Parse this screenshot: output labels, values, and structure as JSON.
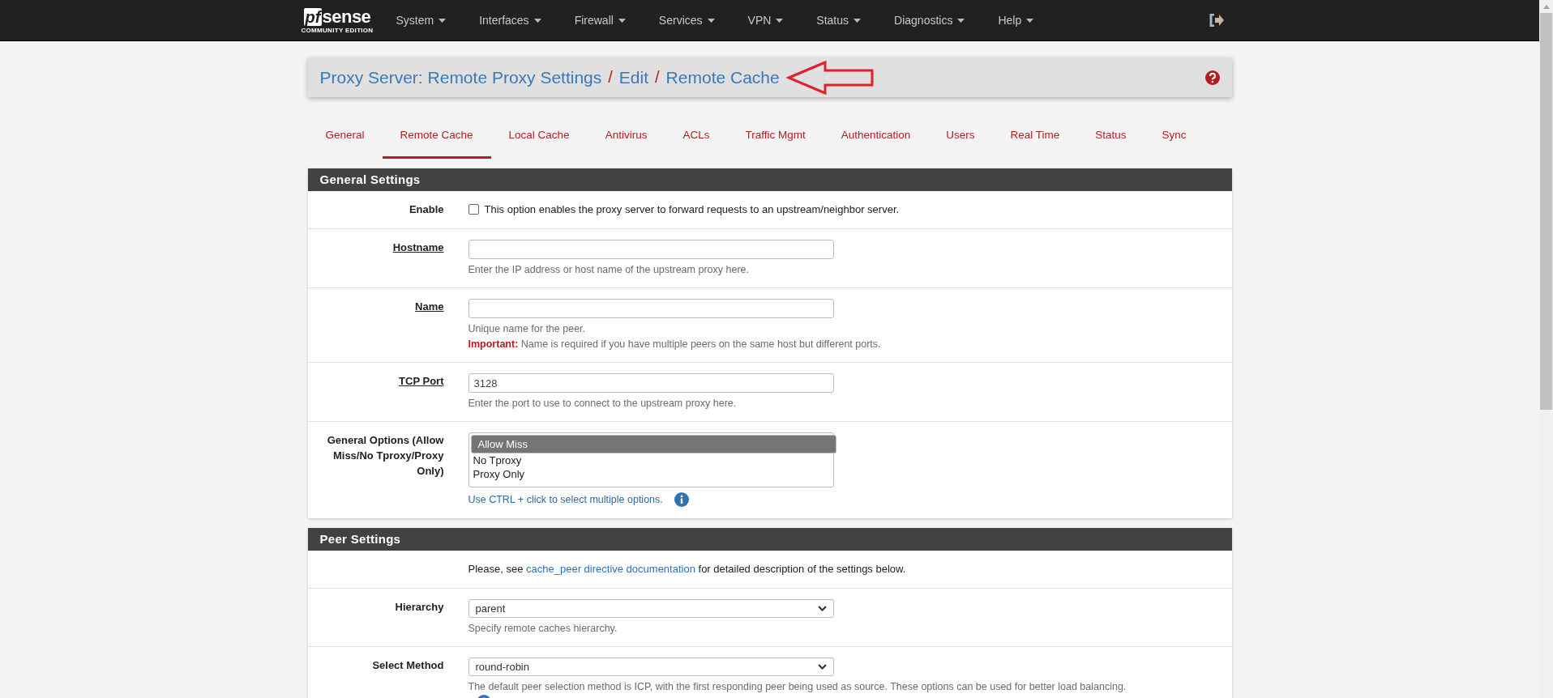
{
  "navbar": {
    "logo": {
      "brand": "sense",
      "mark": "pf",
      "edition": "COMMUNITY EDITION"
    },
    "menus": [
      {
        "label": "System"
      },
      {
        "label": "Interfaces"
      },
      {
        "label": "Firewall"
      },
      {
        "label": "Services"
      },
      {
        "label": "VPN"
      },
      {
        "label": "Status"
      },
      {
        "label": "Diagnostics"
      },
      {
        "label": "Help"
      }
    ]
  },
  "breadcrumb": [
    {
      "label": "Proxy Server: Remote Proxy Settings",
      "separator": "/"
    },
    {
      "label": "Edit",
      "separator": "/"
    },
    {
      "label": "Remote Cache"
    }
  ],
  "tabs": [
    {
      "label": "General",
      "selected": false
    },
    {
      "label": "Remote Cache",
      "selected": true
    },
    {
      "label": "Local Cache",
      "selected": false
    },
    {
      "label": "Antivirus",
      "selected": false
    },
    {
      "label": "ACLs",
      "selected": false
    },
    {
      "label": "Traffic Mgmt",
      "selected": false
    },
    {
      "label": "Authentication",
      "selected": false
    },
    {
      "label": "Users",
      "selected": false
    },
    {
      "label": "Real Time",
      "selected": false
    },
    {
      "label": "Status",
      "selected": false
    },
    {
      "label": "Sync",
      "selected": false
    }
  ],
  "sections": [
    {
      "title": "General Settings",
      "rows": [
        {
          "kind": "checkbox",
          "label": "Enable",
          "underlined": false,
          "checked": false,
          "text": "This option enables the proxy server to forward requests to an upstream/neighbor server."
        },
        {
          "kind": "text",
          "label": "Hostname",
          "underlined": true,
          "value": "",
          "help": [
            "Enter the IP address or host name of the upstream proxy here."
          ]
        },
        {
          "kind": "text",
          "label": "Name",
          "underlined": true,
          "value": "",
          "help": [
            "Unique name for the peer.",
            "**Important:** Name is required if you have multiple peers on the same host but different ports."
          ]
        },
        {
          "kind": "text",
          "label": "TCP Port",
          "underlined": true,
          "value": "3128",
          "help": [
            "Enter the port to use to connect to the upstream proxy here."
          ]
        },
        {
          "kind": "listbox",
          "label": "General Options (Allow Miss/No Tproxy/Proxy Only)",
          "underlined": false,
          "options": [
            {
              "label": "Allow Miss",
              "selected": true
            },
            {
              "label": "No Tproxy",
              "selected": false
            },
            {
              "label": "Proxy Only",
              "selected": false
            }
          ],
          "help_prefix": "Use CTRL + click to select multiple options.",
          "info": true
        }
      ]
    },
    {
      "title": "Peer Settings",
      "rows": [
        {
          "kind": "note",
          "before": "Please, see ",
          "link": "cache_peer directive documentation",
          "after": " for detailed description of the settings below."
        },
        {
          "kind": "select",
          "label": "Hierarchy",
          "underlined": false,
          "value": "parent",
          "help": [
            "Specify remote caches hierarchy."
          ]
        },
        {
          "kind": "select",
          "label": "Select Method",
          "underlined": false,
          "value": "round-robin",
          "help": [
            "The default peer selection method is ICP, with the first responding peer being used as source. These options can be used for better load balancing."
          ],
          "info": true
        }
      ]
    }
  ]
}
